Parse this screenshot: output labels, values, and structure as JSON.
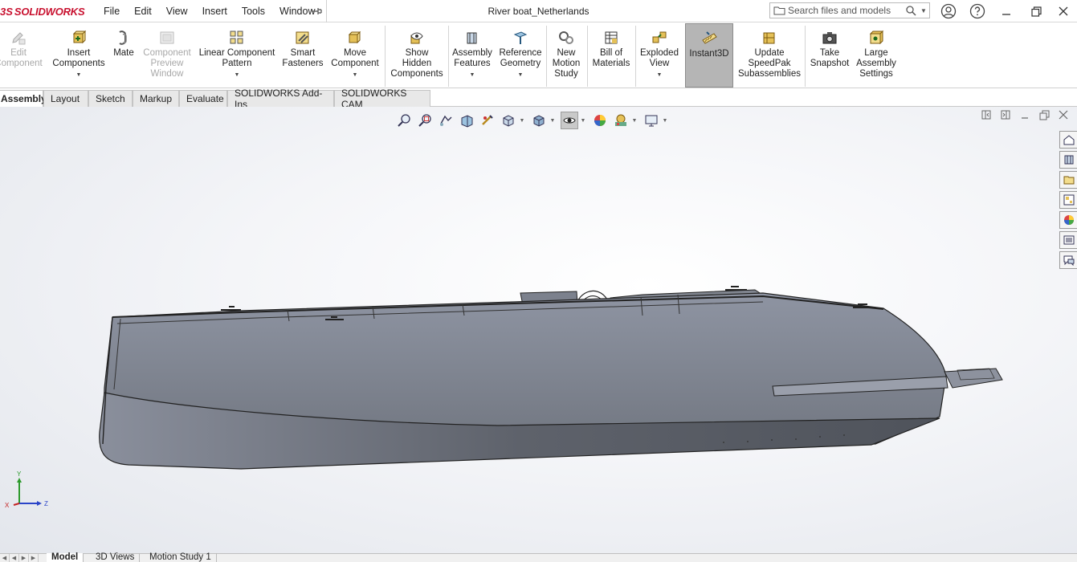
{
  "app": {
    "logo_ds": "3S",
    "logo_name": "SOLIDWORKS",
    "document_title": "River boat_Netherlands"
  },
  "menu": [
    "File",
    "Edit",
    "View",
    "Insert",
    "Tools",
    "Window"
  ],
  "search": {
    "placeholder": "Search files and models"
  },
  "ribbon": {
    "edit_component": [
      "Edit",
      "Component"
    ],
    "insert_components": [
      "Insert",
      "Components"
    ],
    "mate": [
      "Mate"
    ],
    "component_preview": [
      "Component",
      "Preview",
      "Window"
    ],
    "linear_pattern": [
      "Linear Component",
      "Pattern"
    ],
    "smart_fasteners": [
      "Smart",
      "Fasteners"
    ],
    "move_component": [
      "Move",
      "Component"
    ],
    "show_hidden": [
      "Show",
      "Hidden",
      "Components"
    ],
    "assembly_features": [
      "Assembly",
      "Features"
    ],
    "reference_geometry": [
      "Reference",
      "Geometry"
    ],
    "new_motion_study": [
      "New",
      "Motion",
      "Study"
    ],
    "bill_of_materials": [
      "Bill of",
      "Materials"
    ],
    "exploded_view": [
      "Exploded",
      "View"
    ],
    "instant3d": [
      "Instant3D"
    ],
    "update_speedpak": [
      "Update",
      "SpeedPak",
      "Subassemblies"
    ],
    "take_snapshot": [
      "Take",
      "Snapshot"
    ],
    "large_assembly": [
      "Large",
      "Assembly",
      "Settings"
    ]
  },
  "tabs": [
    "Assembly",
    "Layout",
    "Sketch",
    "Markup",
    "Evaluate",
    "SOLIDWORKS Add-Ins",
    "SOLIDWORKS CAM"
  ],
  "triad": {
    "x": "X",
    "y": "Y",
    "z": "Z"
  },
  "bottom_tabs": [
    "Model",
    "3D Views",
    "Motion Study 1"
  ],
  "colors": {
    "brand": "#c8102e",
    "hull": "#8a8f9c",
    "active_tool": "#b5b5b5"
  }
}
